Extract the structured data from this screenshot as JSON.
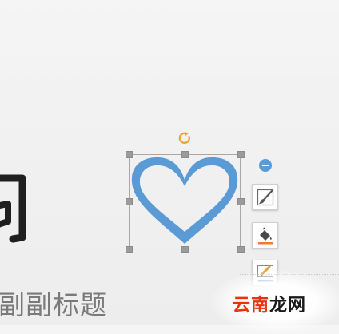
{
  "slide": {
    "subtitle_placeholder": "副副标题"
  },
  "shape": {
    "name": "heart",
    "fill_color": "#5b9bd5",
    "selection_border_color": "#a8a8a8",
    "rotate_icon_color": "#f0a030"
  },
  "side_toolbar": {
    "items": [
      {
        "icon": "minus-circle-icon"
      },
      {
        "icon": "brush-style-icon"
      },
      {
        "icon": "paint-bucket-fill-icon",
        "accent": "#ed7d31"
      },
      {
        "icon": "pencil-outline-icon",
        "accent": "#5b9bd5"
      }
    ]
  },
  "watermark": {
    "part1": "云南",
    "part2": "龙网",
    "color1": "#e8340c",
    "color2": "#1a1a1a"
  }
}
